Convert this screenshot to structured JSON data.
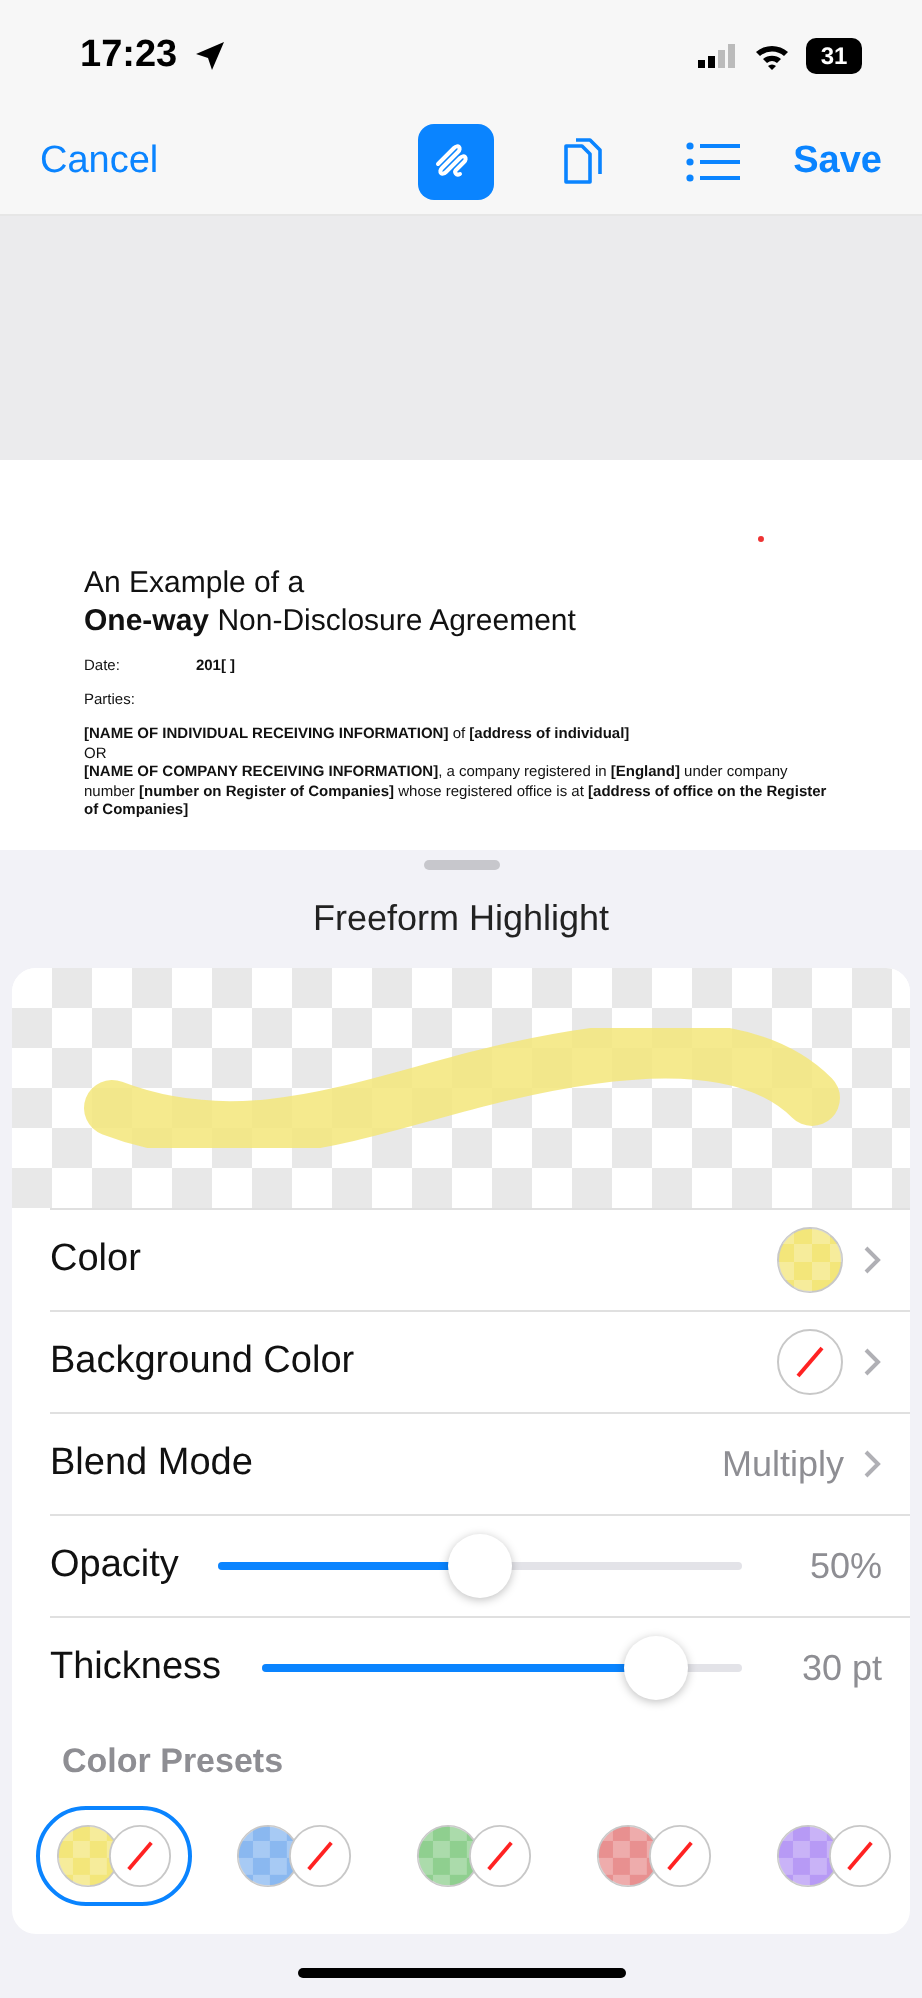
{
  "status_bar": {
    "time": "17:23",
    "battery": "31"
  },
  "nav": {
    "cancel": "Cancel",
    "save": "Save",
    "tools": [
      {
        "kind": "pen",
        "selected": true
      },
      {
        "kind": "pages",
        "selected": false
      },
      {
        "kind": "list",
        "selected": false
      }
    ]
  },
  "document": {
    "title_line_1": "An Example of a",
    "title_line_2": "**One-way** Non-Disclosure Agreement",
    "date_label": "Date:",
    "date_value": "201[ ]",
    "parties_label": "Parties:",
    "paragraphs": [
      "**[NAME OF INDIVIDUAL RECEIVING INFORMATION]** of **[address of individual]**",
      "OR",
      "**[NAME OF COMPANY RECEIVING INFORMATION]**, a company registered in **[England]** under company number **[number on Register of Companies]** whose registered office is at **[address of office on the Register of Companies]**"
    ]
  },
  "sheet": {
    "title": "Freeform Highlight",
    "rows": [
      {
        "kind": "swatch",
        "label": "Color",
        "color": "#f3e67a"
      },
      {
        "kind": "swatch",
        "label": "Background Color"
      },
      {
        "kind": "value",
        "label": "Blend Mode",
        "value": "Multiply"
      },
      {
        "kind": "slider",
        "label": "Opacity",
        "level": 0.5,
        "reading": "50%"
      },
      {
        "kind": "slider",
        "label": "Thickness",
        "level": 0.82,
        "reading": "30 pt"
      }
    ],
    "presets_label": "Color Presets",
    "presets": [
      {
        "color": "#f3e67a",
        "selected": true
      },
      {
        "color": "#8ab8f0",
        "selected": false
      },
      {
        "color": "#8fcf8f",
        "selected": false
      },
      {
        "color": "#e89090",
        "selected": false
      },
      {
        "color": "#b79af5",
        "selected": false
      }
    ]
  }
}
